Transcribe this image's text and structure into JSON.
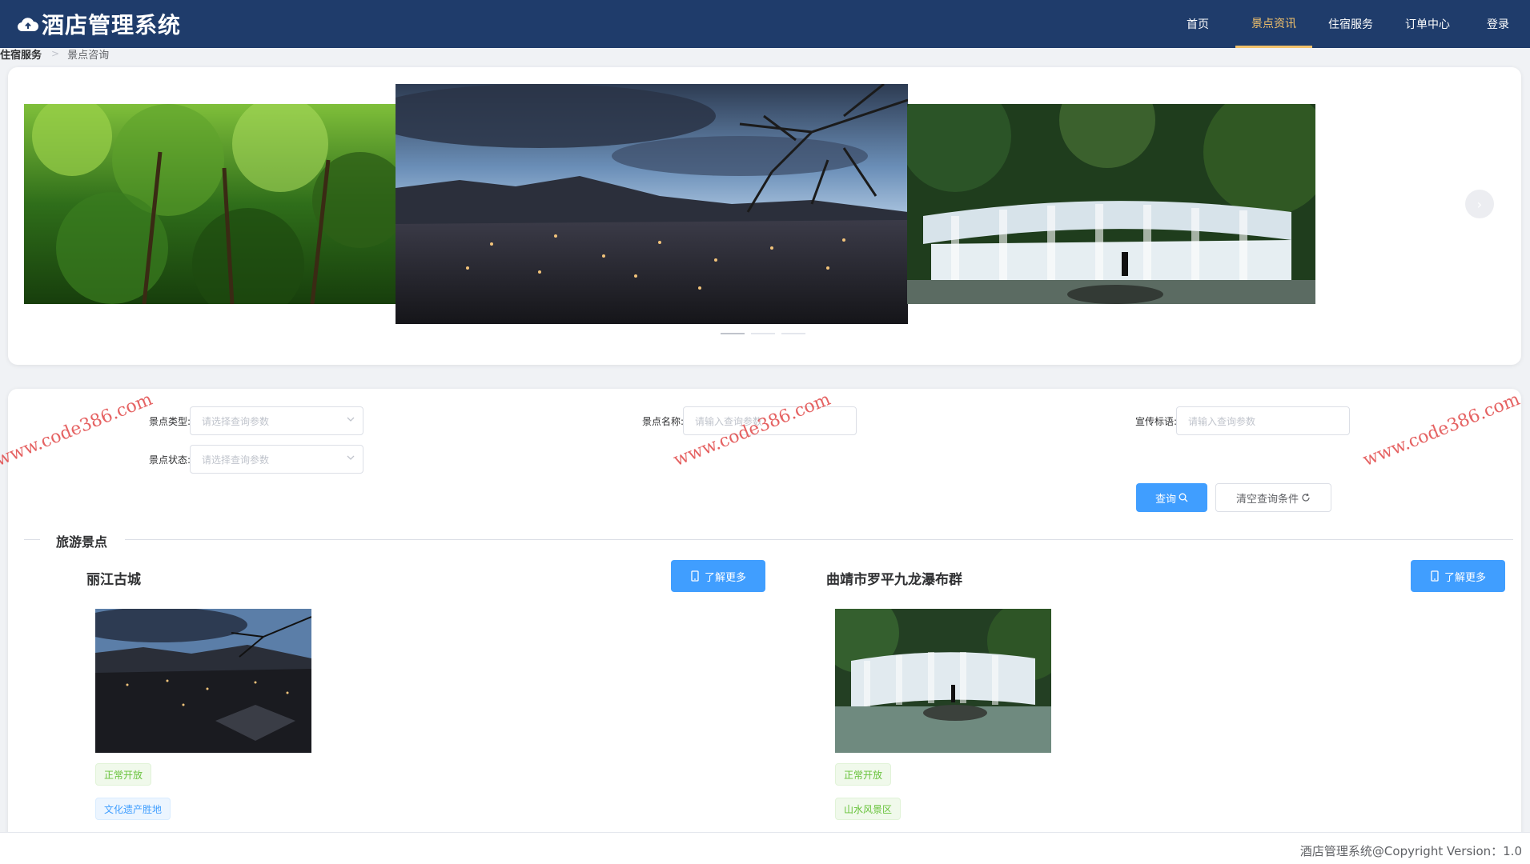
{
  "header": {
    "brand": "酒店管理系统",
    "nav": [
      {
        "label": "首页",
        "active": false
      },
      {
        "label": "景点资讯",
        "active": true
      },
      {
        "label": "住宿服务",
        "active": false
      },
      {
        "label": "订单中心",
        "active": false
      },
      {
        "label": "登录",
        "active": false
      }
    ],
    "active_color": "#f3c26b",
    "bg_color": "#1f3c6b"
  },
  "breadcrumb": {
    "parent": "住宿服务",
    "current": "景点咨询"
  },
  "carousel": {
    "slides": [
      "forest-image",
      "lijiang-town-image",
      "waterfall-image"
    ],
    "active_index": 0,
    "indicator_count": 3
  },
  "search": {
    "type_label": "景点类型:",
    "type_placeholder": "请选择查询参数",
    "name_label": "景点名称:",
    "name_placeholder": "请输入查询参数",
    "slogan_label": "宣传标语:",
    "slogan_placeholder": "请输入查询参数",
    "status_label": "景点状态:",
    "status_placeholder": "请选择查询参数",
    "query_button": "查询",
    "clear_button": "清空查询条件"
  },
  "section": {
    "title": "旅游景点"
  },
  "attractions": [
    {
      "name": "丽江古城",
      "more": "了解更多",
      "status_tag": "正常开放",
      "category_tag": "文化遗产胜地",
      "image": "lijiang-town-image"
    },
    {
      "name": "曲靖市罗平九龙瀑布群",
      "more": "了解更多",
      "status_tag": "正常开放",
      "category_tag": "山水风景区",
      "image": "waterfall-image"
    }
  ],
  "watermark": "www.code386.com",
  "footer": {
    "copyright": "酒店管理系统@Copyright Version：1.0"
  },
  "colors": {
    "primary": "#409eff",
    "success": "#67c23a"
  }
}
